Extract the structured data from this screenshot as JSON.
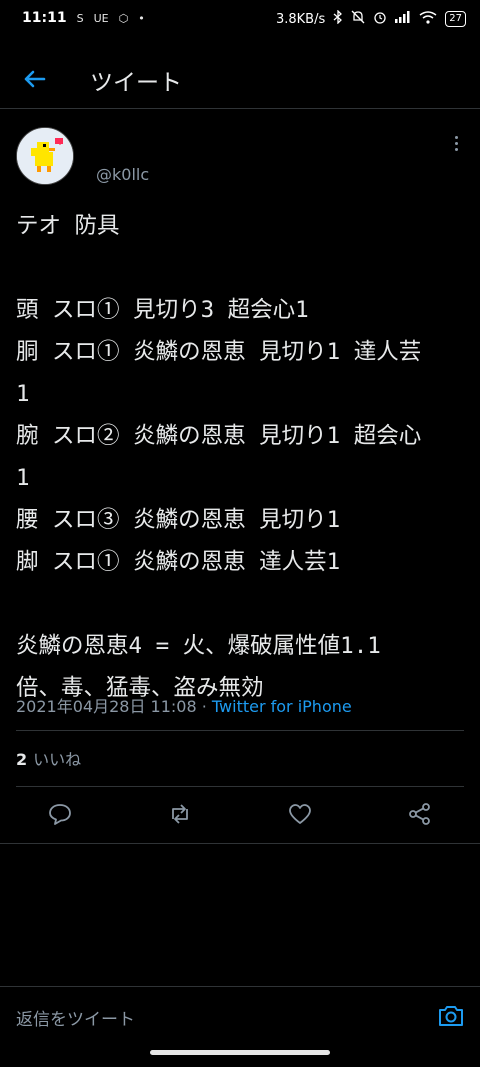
{
  "status_bar": {
    "time": "11:11",
    "left_icons": [
      "S",
      "UE",
      "⬡",
      "•"
    ],
    "speed": "3.8KB/s",
    "right_icons": [
      "✱",
      "🔕",
      "⏰",
      "▮▮▮",
      "wifi"
    ],
    "battery": "27"
  },
  "header": {
    "title": "ツイート"
  },
  "tweet": {
    "username": "@k0llc",
    "text": "テオ 防具\n\n頭 スロ① 見切り3 超会心1\n胴 スロ① 炎鱗の恩恵 見切り1 達人芸\n1\n腕 スロ② 炎鱗の恩恵 見切り1 超会心\n1\n腰 スロ③ 炎鱗の恩恵 見切り1\n脚 スロ① 炎鱗の恩恵 達人芸1\n\n炎鱗の恩恵4 = 火、爆破属性値1.1\n倍、毒、猛毒、盗み無効",
    "timestamp": "2021年04月28日 11:08",
    "separator": " · ",
    "source": "Twitter for iPhone",
    "like_count": "2",
    "like_label": "いいね"
  },
  "reply": {
    "placeholder": "返信をツイート"
  },
  "colors": {
    "accent": "#1d9bf0",
    "background": "#000000",
    "muted": "#8b98a5"
  }
}
